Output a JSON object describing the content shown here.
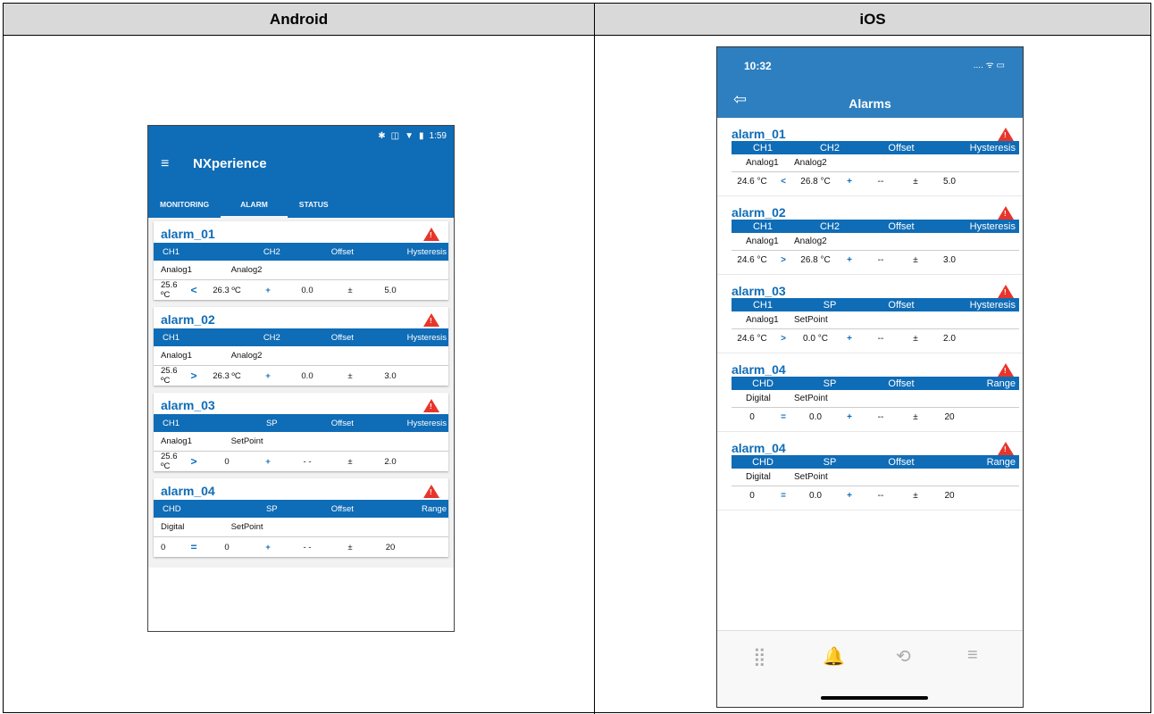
{
  "headers": {
    "android": "Android",
    "ios": "iOS"
  },
  "android": {
    "status": {
      "bt": "✱",
      "vib": "◫",
      "wifi": "▼",
      "battery": "▮",
      "time": "1:59"
    },
    "menu_icon": "≡",
    "title": "NXperience",
    "tabs": [
      "MONITORING",
      "ALARM",
      "STATUS"
    ],
    "alarms": [
      {
        "name": "alarm_01",
        "cols": [
          "CH1",
          "CH2",
          "Offset",
          "Hysteresis"
        ],
        "src": [
          "Analog1",
          "Analog2"
        ],
        "vals": [
          "25.6 ºC",
          "<",
          "26.3 ºC",
          "+",
          "0.0",
          "±",
          "5.0"
        ]
      },
      {
        "name": "alarm_02",
        "cols": [
          "CH1",
          "CH2",
          "Offset",
          "Hysteresis"
        ],
        "src": [
          "Analog1",
          "Analog2"
        ],
        "vals": [
          "25.6 ºC",
          ">",
          "26.3 ºC",
          "+",
          "0.0",
          "±",
          "3.0"
        ]
      },
      {
        "name": "alarm_03",
        "cols": [
          "CH1",
          "SP",
          "Offset",
          "Hysteresis"
        ],
        "src": [
          "Analog1",
          "SetPoint"
        ],
        "vals": [
          "25.6 ºC",
          ">",
          "0",
          "+",
          "- -",
          "±",
          "2.0"
        ]
      },
      {
        "name": "alarm_04",
        "cols": [
          "CHD",
          "SP",
          "Offset",
          "Range"
        ],
        "src": [
          "Digital",
          "SetPoint"
        ],
        "vals": [
          "0",
          "=",
          "0",
          "+",
          "- -",
          "±",
          "20"
        ]
      }
    ]
  },
  "ios": {
    "time": "10:32",
    "signal": "....  ᯤ ▭",
    "back_icon": "⇦",
    "title": "Alarms",
    "alarms": [
      {
        "name": "alarm_01",
        "cols": [
          "CH1",
          "CH2",
          "Offset",
          "Hysteresis"
        ],
        "src": [
          "Analog1",
          "Analog2"
        ],
        "vals": [
          "24.6 °C",
          "<",
          "26.8 °C",
          "+",
          "--",
          "±",
          "5.0"
        ]
      },
      {
        "name": "alarm_02",
        "cols": [
          "CH1",
          "CH2",
          "Offset",
          "Hysteresis"
        ],
        "src": [
          "Analog1",
          "Analog2"
        ],
        "vals": [
          "24.6 °C",
          ">",
          "26.8 °C",
          "+",
          "--",
          "±",
          "3.0"
        ]
      },
      {
        "name": "alarm_03",
        "cols": [
          "CH1",
          "SP",
          "Offset",
          "Hysteresis"
        ],
        "src": [
          "Analog1",
          "SetPoint"
        ],
        "vals": [
          "24.6 °C",
          ">",
          "0.0 °C",
          "+",
          "--",
          "±",
          "2.0"
        ]
      },
      {
        "name": "alarm_04",
        "cols": [
          "CHD",
          "SP",
          "Offset",
          "Range"
        ],
        "src": [
          "Digital",
          "SetPoint"
        ],
        "vals": [
          "0",
          "=",
          "0.0",
          "+",
          "--",
          "±",
          "20"
        ]
      },
      {
        "name": "alarm_04",
        "cols": [
          "CHD",
          "SP",
          "Offset",
          "Range"
        ],
        "src": [
          "Digital",
          "SetPoint"
        ],
        "vals": [
          "0",
          "=",
          "0.0",
          "+",
          "--",
          "±",
          "20"
        ]
      }
    ],
    "tabbar": {
      "monitoring_icon": "⣿",
      "alarm_icon": "🔔",
      "status_icon": "⟲",
      "menu_icon": "≡"
    }
  },
  "colors": {
    "primary": "#0f6cb6",
    "ios_bar": "#2d7fc0",
    "warning": "#e8352b"
  }
}
